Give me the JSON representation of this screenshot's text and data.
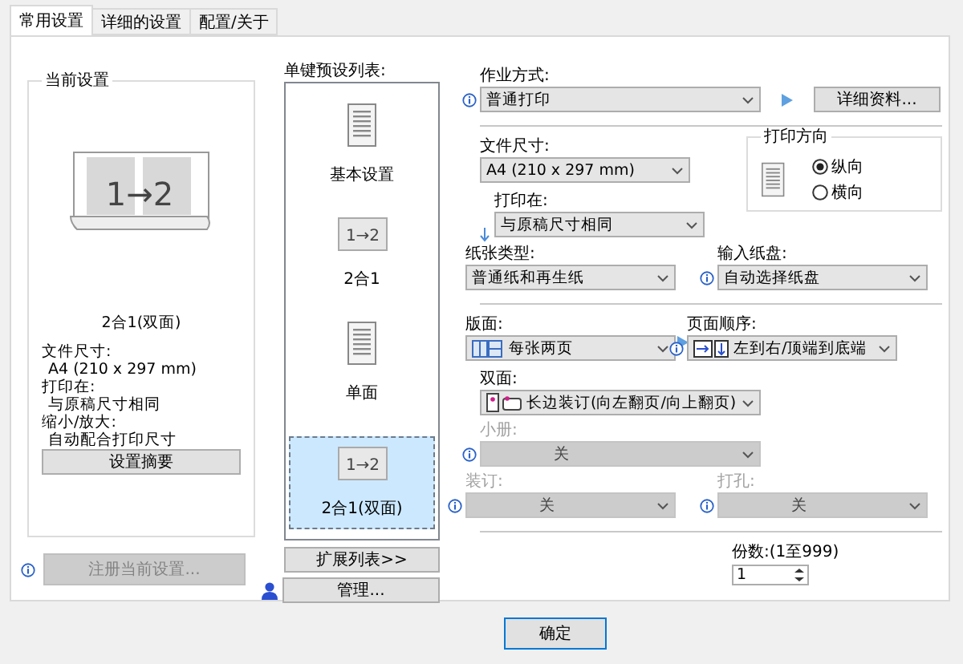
{
  "tabs": [
    {
      "label": "常用设置",
      "selected": true
    },
    {
      "label": "详细的设置",
      "selected": false
    },
    {
      "label": "配置/关于",
      "selected": false
    }
  ],
  "current_settings": {
    "title": "当前设置",
    "preview_text": "1→2",
    "preview_caption": "2合1(双面)",
    "details": [
      {
        "label": "文件尺寸:",
        "value": "A4 (210 x 297 mm)"
      },
      {
        "label": "打印在:",
        "value": "与原稿尺寸相同"
      },
      {
        "label": "缩小/放大:",
        "value": "自动配合打印尺寸"
      }
    ],
    "summary_button": "设置摘要"
  },
  "register_button": {
    "label": "注册当前设置...",
    "disabled": true
  },
  "presets": {
    "title": "单键预设列表:",
    "items": [
      {
        "label": "基本设置",
        "kind": "sheet",
        "selected": false
      },
      {
        "label": "2合1",
        "kind": "two-in-one",
        "icon_text": "1→2",
        "selected": false
      },
      {
        "label": "单面",
        "kind": "sheet",
        "selected": false
      },
      {
        "label": "2合1(双面)",
        "kind": "two-in-one",
        "icon_text": "1→2",
        "selected": true
      }
    ],
    "expand_button": "扩展列表>>",
    "manage_button": "管理..."
  },
  "job": {
    "label": "作业方式:",
    "value": "普通打印",
    "info": true,
    "disabled": false,
    "details_button": "详细资料..."
  },
  "document_size": {
    "label": "文件尺寸:",
    "value": "A4 (210 x 297 mm)",
    "info": false,
    "disabled": false
  },
  "print_on": {
    "label": "打印在:",
    "value": "与原稿尺寸相同",
    "info": false,
    "disabled": false
  },
  "orientation": {
    "title": "打印方向",
    "options": [
      {
        "label": "纵向",
        "selected": true
      },
      {
        "label": "横向",
        "selected": false
      }
    ]
  },
  "paper_type": {
    "label": "纸张类型:",
    "value": "普通纸和再生纸",
    "info": false,
    "disabled": false
  },
  "input_tray": {
    "label": "输入纸盘:",
    "value": "自动选择纸盘",
    "info": true,
    "disabled": false
  },
  "layout": {
    "label": "版面:",
    "value": "每张两页",
    "info": false,
    "disabled": false
  },
  "page_order": {
    "label": "页面顺序:",
    "value": "左到右/顶端到底端",
    "info": true,
    "disabled": false
  },
  "duplex": {
    "label": "双面:",
    "value": "长边装订(向左翻页/向上翻页)",
    "info": false,
    "disabled": false
  },
  "booklet": {
    "label": "小册:",
    "value": "关",
    "info": true,
    "disabled": true
  },
  "binding": {
    "label": "装订:",
    "value": "关",
    "info": true,
    "disabled": true
  },
  "punch": {
    "label": "打孔:",
    "value": "关",
    "info": true,
    "disabled": true
  },
  "copies": {
    "label": "份数:(1至999)",
    "value": "1"
  },
  "ok_button": "确定"
}
